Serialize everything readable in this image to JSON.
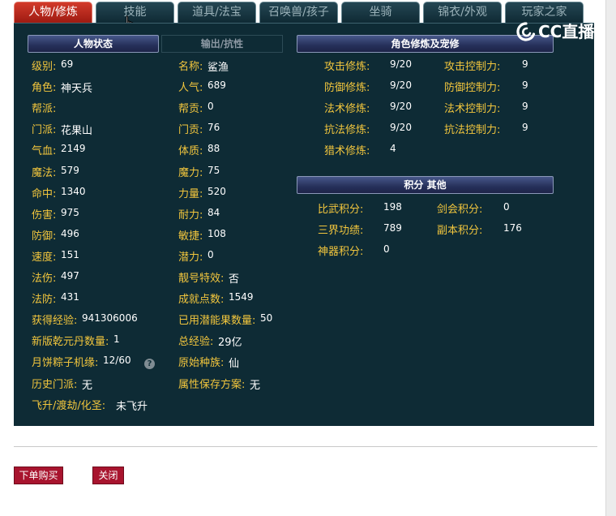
{
  "tabs": [
    "人物/修炼",
    "技能",
    "道具/法宝",
    "召唤兽/孩子",
    "坐骑",
    "锦衣/外观",
    "玩家之家"
  ],
  "active_tab": "人物/修炼",
  "left_panel": {
    "header": "人物状态",
    "alt_tab": "输出/抗性"
  },
  "right_panel": {
    "header": "角色修炼及宠修",
    "score_header": "积分 其他"
  },
  "logo_text": "CC直播",
  "stats_left": [
    {
      "label": "级别:",
      "value": "69"
    },
    {
      "label": "角色:",
      "value": "神天兵"
    },
    {
      "label": "帮派:",
      "value": ""
    },
    {
      "label": "门派:",
      "value": "花果山"
    },
    {
      "label": "气血:",
      "value": "2149"
    },
    {
      "label": "魔法:",
      "value": "579"
    },
    {
      "label": "命中:",
      "value": "1340"
    },
    {
      "label": "伤害:",
      "value": "975"
    },
    {
      "label": "防御:",
      "value": "496"
    },
    {
      "label": "速度:",
      "value": "151"
    },
    {
      "label": "法伤:",
      "value": "497"
    },
    {
      "label": "法防:",
      "value": "431"
    },
    {
      "label": "获得经验:",
      "value": "941306006"
    },
    {
      "label": "新版乾元丹数量:",
      "value": "1"
    },
    {
      "label": "月饼粽子机缘:",
      "value": "12/60"
    },
    {
      "label": "历史门派:",
      "value": "无"
    },
    {
      "label": "飞升/渡劫/化圣:",
      "value": "未飞升"
    }
  ],
  "stats_mid": [
    {
      "label": "名称:",
      "value": "鲨渔"
    },
    {
      "label": "人气:",
      "value": "689"
    },
    {
      "label": "帮贡:",
      "value": "0"
    },
    {
      "label": "门贡:",
      "value": "76"
    },
    {
      "label": "体质:",
      "value": "88"
    },
    {
      "label": "魔力:",
      "value": "75"
    },
    {
      "label": "力量:",
      "value": "520"
    },
    {
      "label": "耐力:",
      "value": "84"
    },
    {
      "label": "敏捷:",
      "value": "108"
    },
    {
      "label": "潜力:",
      "value": "0"
    },
    {
      "label": "靓号特效:",
      "value": "否"
    },
    {
      "label": "成就点数:",
      "value": "1549"
    },
    {
      "label": "已用潜能果数量:",
      "value": "50"
    },
    {
      "label": "总经验:",
      "value": "29亿"
    },
    {
      "label": "原始种族:",
      "value": "仙"
    },
    {
      "label": "属性保存方案:",
      "value": "无"
    }
  ],
  "cultivation": [
    {
      "label": "攻击修炼:",
      "value": "9/20",
      "label2": "攻击控制力:",
      "value2": "9"
    },
    {
      "label": "防御修炼:",
      "value": "9/20",
      "label2": "防御控制力:",
      "value2": "9"
    },
    {
      "label": "法术修炼:",
      "value": "9/20",
      "label2": "法术控制力:",
      "value2": "9"
    },
    {
      "label": "抗法修炼:",
      "value": "9/20",
      "label2": "抗法控制力:",
      "value2": "9"
    },
    {
      "label": "猎术修炼:",
      "value": "4"
    }
  ],
  "scores": [
    {
      "label": "比武积分:",
      "value": "198",
      "label2": "剑会积分:",
      "value2": "0"
    },
    {
      "label": "三界功绩:",
      "value": "789",
      "label2": "副本积分:",
      "value2": "176"
    },
    {
      "label": "神器积分:",
      "value": "0"
    }
  ],
  "buttons": {
    "buy": "下单购买",
    "close": "关闭"
  },
  "colors": {
    "label": "#f2c63d",
    "value": "#ffffff",
    "panel": "#0e2b35",
    "active_tab": "#c02a1e",
    "button": "#a8142e"
  }
}
